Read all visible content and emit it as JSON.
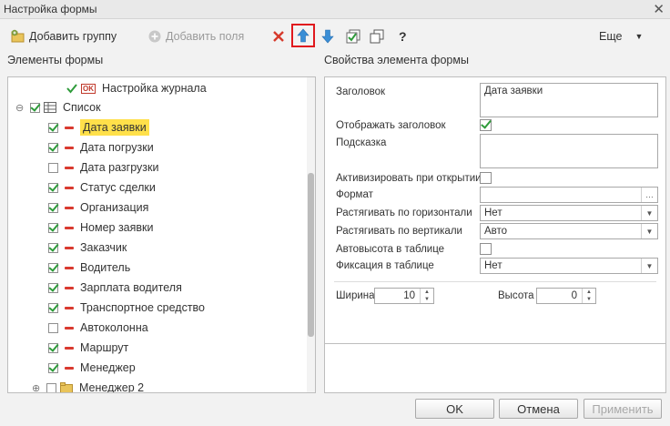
{
  "window": {
    "title": "Настройка формы"
  },
  "toolbar": {
    "add_group": "Добавить группу",
    "add_field": "Добавить поля",
    "help": "?",
    "more": "Еще"
  },
  "left": {
    "title": "Элементы формы",
    "top_item": "Настройка журнала",
    "top_item_badge": "OK",
    "list_node": "Список",
    "items": [
      {
        "label": "Дата заявки",
        "checked": true,
        "selected": true
      },
      {
        "label": "Дата погрузки",
        "checked": true
      },
      {
        "label": "Дата разгрузки",
        "checked": false
      },
      {
        "label": "Статус сделки",
        "checked": true
      },
      {
        "label": "Организация",
        "checked": true
      },
      {
        "label": "Номер заявки",
        "checked": true
      },
      {
        "label": "Заказчик",
        "checked": true
      },
      {
        "label": "Водитель",
        "checked": true
      },
      {
        "label": "Зарплата водителя",
        "checked": true
      },
      {
        "label": "Транспортное средство",
        "checked": true
      },
      {
        "label": "Автоколонна",
        "checked": false
      },
      {
        "label": "Маршрут",
        "checked": true
      },
      {
        "label": "Менеджер",
        "checked": true
      }
    ],
    "bottom_item": "Менеджер 2"
  },
  "right": {
    "title": "Свойства элемента формы",
    "caption_label": "Заголовок",
    "caption_value": "Дата заявки",
    "show_caption_label": "Отображать заголовок",
    "hint_label": "Подсказка",
    "activate_label": "Активизировать при открытии",
    "format_label": "Формат",
    "hstretch_label": "Растягивать по горизонтали",
    "hstretch_value": "Нет",
    "vstretch_label": "Растягивать по вертикали",
    "vstretch_value": "Авто",
    "autoheight_label": "Автовысота в таблице",
    "fix_label": "Фиксация в таблице",
    "fix_value": "Нет",
    "width_label": "Ширина",
    "width_value": "10",
    "height_label": "Высота",
    "height_value": "0"
  },
  "buttons": {
    "ok": "OK",
    "cancel": "Отмена",
    "apply": "Применить"
  }
}
